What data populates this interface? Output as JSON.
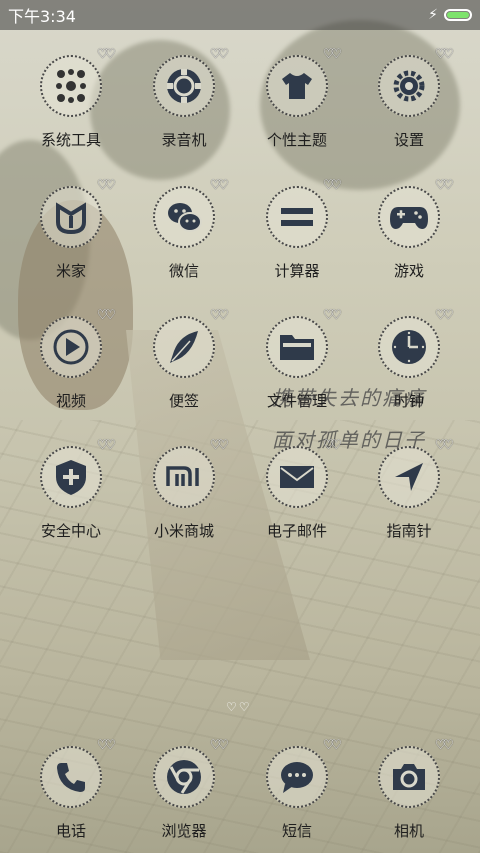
{
  "status_bar": {
    "time": "下午3:34",
    "charging_icon": "bolt-icon",
    "battery_level": 1.0,
    "battery_color": "#7ee36c"
  },
  "wallpaper": {
    "line1": "携带失去的痛痛",
    "line2": "面对孤单的日子"
  },
  "home_apps": [
    {
      "label": "系统工具",
      "icon": "tools-folder-icon"
    },
    {
      "label": "录音机",
      "icon": "recorder-icon"
    },
    {
      "label": "个性主题",
      "icon": "tshirt-icon"
    },
    {
      "label": "设置",
      "icon": "gear-icon"
    },
    {
      "label": "米家",
      "icon": "mijia-icon"
    },
    {
      "label": "微信",
      "icon": "wechat-icon"
    },
    {
      "label": "计算器",
      "icon": "calculator-icon"
    },
    {
      "label": "游戏",
      "icon": "gamepad-icon"
    },
    {
      "label": "视频",
      "icon": "play-icon"
    },
    {
      "label": "便签",
      "icon": "feather-icon"
    },
    {
      "label": "文件管理",
      "icon": "folder-icon"
    },
    {
      "label": "时钟",
      "icon": "clock-icon"
    },
    {
      "label": "安全中心",
      "icon": "shield-icon"
    },
    {
      "label": "小米商城",
      "icon": "mi-store-icon"
    },
    {
      "label": "电子邮件",
      "icon": "mail-icon"
    },
    {
      "label": "指南针",
      "icon": "compass-icon"
    }
  ],
  "dock_apps": [
    {
      "label": "电话",
      "icon": "phone-icon"
    },
    {
      "label": "浏览器",
      "icon": "browser-icon"
    },
    {
      "label": "短信",
      "icon": "message-icon"
    },
    {
      "label": "相机",
      "icon": "camera-icon"
    }
  ],
  "pager": {
    "indicator": "heart-dots-icon"
  }
}
